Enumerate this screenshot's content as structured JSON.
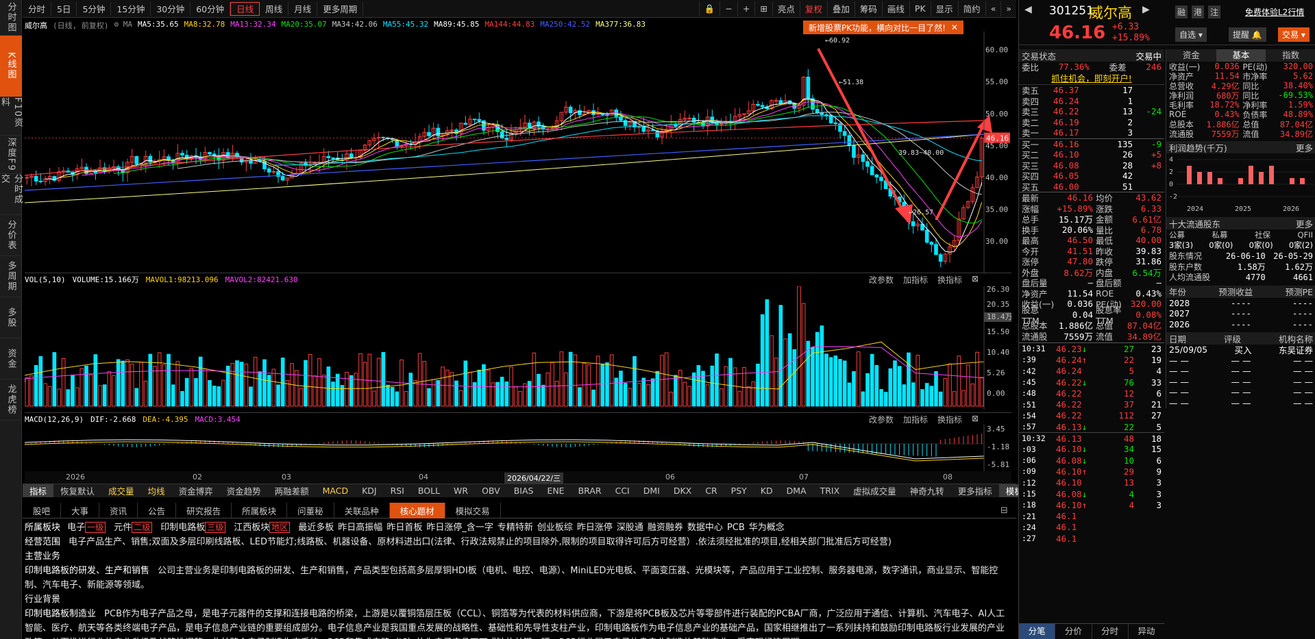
{
  "left_nav": [
    "分时图",
    "K线图",
    "F10资料",
    "深度F9",
    "分时成交",
    "分价表",
    "多周期",
    "多股",
    "资金",
    "龙虎榜"
  ],
  "left_nav_active": 1,
  "toolbar": {
    "periods": [
      "分时",
      "5日",
      "5分钟",
      "15分钟",
      "30分钟",
      "60分钟",
      "日线",
      "周线",
      "月线",
      "更多周期"
    ],
    "active_period": 6,
    "right_tools": [
      "亮点",
      "复权",
      "叠加",
      "筹码",
      "画线",
      "PK",
      "显示",
      "简约"
    ]
  },
  "stock_label": "威尔高",
  "mode_label": "(日线, 前复权)",
  "ma": [
    {
      "label": "MA5:35.65",
      "color": "#ffffff"
    },
    {
      "label": "MA8:32.78",
      "color": "#ffd700"
    },
    {
      "label": "MA13:32.34",
      "color": "#ff40ff"
    },
    {
      "label": "MA20:35.07",
      "color": "#00e600"
    },
    {
      "label": "MA34:42.06",
      "color": "#c8c8c8"
    },
    {
      "label": "MA55:45.32",
      "color": "#00e5ff"
    },
    {
      "label": "MA89:45.85",
      "color": "#ffffff"
    },
    {
      "label": "MA144:44.83",
      "color": "#ff3c3c"
    },
    {
      "label": "MA250:42.52",
      "color": "#4060ff"
    },
    {
      "label": "MA377:36.83",
      "color": "#ffff80"
    }
  ],
  "promo": "新增股票PK功能，横向对比一目了然!",
  "price_axis": [
    "60.00",
    "55.00",
    "50.00",
    "45.00",
    "40.00",
    "35.00",
    "30.00"
  ],
  "annotations": {
    "high": "60.92",
    "mid": "51.38",
    "low": "26.57",
    "range": "39.83~40.00",
    "current": "46.16"
  },
  "vol": {
    "label": "VOL(5,10)",
    "volume": "VOLUME:15.166万",
    "mavol1": "MAVOL1:98213.096",
    "mavol2": "MAVOL2:82421.630",
    "axis": [
      "26.30",
      "20.35",
      "18.4万",
      "15.50",
      "10.40",
      "5.26",
      "0.00"
    ]
  },
  "macd": {
    "label": "MACD(12,26,9)",
    "dif": "DIF:-2.668",
    "dea": "DEA:-4.395",
    "macd": "MACD:3.454",
    "axis": [
      "3.45",
      "-1.18",
      "-5.81"
    ]
  },
  "panel_tools": [
    "改参数",
    "加指标",
    "换指标"
  ],
  "dates": [
    "2026",
    "02",
    "03",
    "04",
    "2026/04/22/三",
    "06",
    "07",
    "08"
  ],
  "indicators": [
    "指标",
    "恢复默认",
    "成交量",
    "均线",
    "资金博弈",
    "资金趋势",
    "两融差额",
    "MACD",
    "KDJ",
    "RSI",
    "BOLL",
    "WR",
    "OBV",
    "BIAS",
    "ENE",
    "BRAR",
    "CCI",
    "DMI",
    "DKX",
    "CR",
    "PSY",
    "KD",
    "DMA",
    "TRIX",
    "虚拟成交量",
    "神奇九转",
    "更多指标",
    "模板"
  ],
  "info_tabs": [
    "股吧",
    "大事",
    "资讯",
    "公告",
    "研究报告",
    "所属板块",
    "问董秘",
    "关联品种",
    "核心题材",
    "模拟交易"
  ],
  "info_active": 8,
  "info": {
    "sector_label": "所属板块",
    "sectors": [
      "电子",
      "一级",
      "元件",
      "二级",
      "印制电路板",
      "三级",
      "江西板块",
      "地区",
      "最近多板",
      "昨日高振幅",
      "昨日首板",
      "昨日涨停_含一字",
      "专精特新",
      "创业板综",
      "昨日涨停",
      "深股通",
      "融资融券",
      "数据中心",
      "PCB",
      "华为概念"
    ],
    "scope_label": "经营范围",
    "scope": "电子产品生产、销售;双面及多层印刷线路板、LED节能灯;线路板、机器设备、原材料进出口(法律、行政法规禁止的项目除外,限制的项目取得许可后方可经营）.依法须经批准的项目,经相关部门批准后方可经营)",
    "main_label": "主营业务",
    "main_title": "印制电路板的研发、生产和销售",
    "main_text": "公司主营业务是印制电路板的研发、生产和销售，产品类型包括高多层厚铜HDI板（电机、电控、电源）、MiniLED光电板、平面变压器、光模块等，产品应用于工业控制、服务器电源，数字通讯，商业显示、智能控制、汽车电子、新能源等领域。",
    "bg_label": "行业背景",
    "bg_title": "印制电路板制造业",
    "bg_text": "PCB作为电子产品之母，是电子元器件的支撑和连接电路的桥梁，上游是以覆铜箔层压板（CCL）、铜箔等为代表的材料供应商，下游是将PCB板及芯片等零部件进行装配的PCBA厂商，广泛应用于通信、计算机、汽车电子、AI人工智能、医疗、航天等各类终端电子产品，是电子信息产业链的重要组成部分。电子信息产业是我国重点发展的战略性、基础性和先导性支柱产业，印制电路板作为电子信息产业的基础产品，国家相继推出了一系列扶持和鼓励印制电路板行业发展的产业政策。从而推进行业的产业升级及战略性调整，此前整个电子制造生态系统，PCB和集成电路（IC）均为电子产品不可或缺的关键一环，PCB行业属于电子信息产业制造的基础产业，受宏观经济周期"
  },
  "right": {
    "code": "301251",
    "name": "威尔高",
    "price": "46.16",
    "change": "+6.33",
    "pct": "+15.89%",
    "header_links": [
      "融",
      "港",
      "注"
    ],
    "free_trial": "免费体验L2行情",
    "btn_watch": "自选",
    "btn_alert": "提醒",
    "btn_trade": "交易",
    "trade_status_label": "交易状态",
    "trade_status": "交易中",
    "webi_label": "委比",
    "webi": "77.36%",
    "weicha_label": "委差",
    "weicha": "246",
    "ad": "抓住机会，即刻开户!",
    "asks": [
      {
        "l": "卖五",
        "p": "46.37",
        "v": "17",
        "c": ""
      },
      {
        "l": "卖四",
        "p": "46.24",
        "v": "1",
        "c": ""
      },
      {
        "l": "卖三",
        "p": "46.22",
        "v": "13",
        "c": "-24"
      },
      {
        "l": "卖二",
        "p": "46.19",
        "v": "2",
        "c": ""
      },
      {
        "l": "卖一",
        "p": "46.17",
        "v": "3",
        "c": ""
      }
    ],
    "bids": [
      {
        "l": "买一",
        "p": "46.16",
        "v": "135",
        "c": "-9"
      },
      {
        "l": "买二",
        "p": "46.10",
        "v": "26",
        "c": "+5"
      },
      {
        "l": "买三",
        "p": "46.08",
        "v": "28",
        "c": "+8"
      },
      {
        "l": "买四",
        "p": "46.05",
        "v": "42",
        "c": ""
      },
      {
        "l": "买五",
        "p": "46.00",
        "v": "51",
        "c": ""
      }
    ],
    "stats": [
      [
        "最新",
        "46.16",
        "均价",
        "43.62"
      ],
      [
        "涨幅",
        "+15.89%",
        "涨跌",
        "6.33"
      ],
      [
        "总手",
        "15.17万",
        "金额",
        "6.61亿"
      ],
      [
        "换手",
        "20.06%",
        "量比",
        "6.78"
      ],
      [
        "最高",
        "46.50",
        "最低",
        "40.00"
      ],
      [
        "今开",
        "41.51",
        "昨收",
        "39.83"
      ],
      [
        "涨停",
        "47.80",
        "跌停",
        "31.86"
      ],
      [
        "外盘",
        "8.62万",
        "内盘",
        "6.54万"
      ],
      [
        "盘后量",
        "—",
        "盘后额",
        "—"
      ],
      [
        "净资产",
        "11.54",
        "ROE",
        "0.43%"
      ],
      [
        "收益(一)",
        "0.036",
        "PE(动)",
        "320.00"
      ],
      [
        "股息TTM",
        "0.04",
        "股息率TTM",
        "0.08%"
      ],
      [
        "总股本",
        "1.886亿",
        "总值",
        "87.04亿"
      ],
      [
        "流通股",
        "7559万",
        "流值",
        "34.89亿"
      ]
    ],
    "ticks": [
      [
        "10:31",
        "46.23",
        "27",
        "23",
        "d"
      ],
      [
        ":39",
        "46.24",
        "22",
        "19",
        "u"
      ],
      [
        ":42",
        "46.24",
        "5",
        "4",
        ""
      ],
      [
        ":45",
        "46.22",
        "76",
        "33",
        "d"
      ],
      [
        ":48",
        "46.22",
        "12",
        "6",
        ""
      ],
      [
        ":51",
        "46.22",
        "37",
        "21",
        ""
      ],
      [
        ":54",
        "46.22",
        "112",
        "27",
        ""
      ],
      [
        ":57",
        "46.13",
        "22",
        "5",
        "d"
      ],
      [
        "10:32",
        "46.13",
        "48",
        "18",
        ""
      ],
      [
        ":03",
        "46.10",
        "34",
        "15",
        "d"
      ],
      [
        ":06",
        "46.08",
        "10",
        "6",
        "d"
      ],
      [
        ":09",
        "46.10",
        "29",
        "9",
        "u"
      ],
      [
        ":12",
        "46.10",
        "13",
        "3",
        ""
      ],
      [
        ":15",
        "46.08",
        "4",
        "3",
        "d"
      ],
      [
        ":18",
        "46.10",
        "4",
        "3",
        "u"
      ],
      [
        ":21",
        "46.1",
        "",
        "",
        ""
      ],
      [
        ":24",
        "46.1",
        "",
        "",
        ""
      ],
      [
        ":27",
        "46.1",
        "",
        "",
        ""
      ]
    ],
    "bottom_tabs": [
      "分笔",
      "分价",
      "分时",
      "异动"
    ],
    "f_tabs": [
      "资金",
      "基本",
      "指数"
    ],
    "fundamentals": [
      [
        "收益(一)",
        "0.036",
        "PE(动)",
        "320.00"
      ],
      [
        "净资产",
        "11.54",
        "市净率",
        "5.62"
      ],
      [
        "总营收",
        "4.29亿",
        "同比",
        "38.40%"
      ],
      [
        "净利润",
        "680万",
        "同比",
        "-69.53%"
      ],
      [
        "毛利率",
        "18.72%",
        "净利率",
        "1.59%"
      ],
      [
        "ROE",
        "0.43%",
        "负债率",
        "48.89%"
      ],
      [
        "总股本",
        "1.886亿",
        "总值",
        "87.04亿"
      ],
      [
        "流通股",
        "7559万",
        "流值",
        "34.89亿"
      ]
    ],
    "profit_title": "利润趋势(千万)",
    "more": "更多",
    "profit_years": [
      "2024",
      "2025",
      "2026"
    ],
    "profit_values": [
      3,
      2,
      2,
      1,
      0,
      1,
      3,
      2,
      3,
      0,
      1,
      1
    ],
    "holders_title": "十大流通股东",
    "holder_cols": [
      "公募",
      "私募",
      "社保",
      "QFII"
    ],
    "holder_vals": [
      "3家(3)",
      "0家(0)",
      "0家(0)",
      "0家(2)"
    ],
    "holder_info": [
      [
        "股东情况",
        "26-06-10",
        "26-05-29"
      ],
      [
        "股东户数",
        "1.58万",
        "1.62万"
      ],
      [
        "人均流通股",
        "4770",
        "4661"
      ]
    ],
    "forecast_cols": [
      "年份",
      "预测收益",
      "预测PE"
    ],
    "forecast_rows": [
      [
        "2028",
        "----",
        "----"
      ],
      [
        "2027",
        "----",
        "----"
      ],
      [
        "2026",
        "----",
        "----"
      ]
    ],
    "rating_cols": [
      "日期",
      "评级",
      "机构名称"
    ],
    "rating_rows": [
      [
        "25/09/05",
        "买入",
        "东吴证券"
      ]
    ]
  },
  "chart_data": {
    "type": "candlestick",
    "x_ticks": [
      "2026",
      "02",
      "03",
      "04",
      "06",
      "07",
      "08"
    ],
    "ylim": [
      26.57,
      60.92
    ],
    "recent": {
      "high": 60.92,
      "low": 26.57,
      "last": 46.16,
      "prev_close": 39.83
    }
  }
}
